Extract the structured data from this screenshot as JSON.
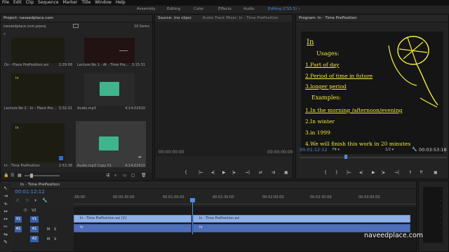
{
  "menu": [
    "File",
    "Edit",
    "Clip",
    "Sequence",
    "Marker",
    "Title",
    "Window",
    "Help"
  ],
  "workspaces": [
    {
      "label": "Assembly",
      "active": false
    },
    {
      "label": "Editing",
      "active": false
    },
    {
      "label": "Color",
      "active": false
    },
    {
      "label": "Effects",
      "active": false
    },
    {
      "label": "Audio",
      "active": false
    },
    {
      "label": "Editing (CS5.5)",
      "active": true
    }
  ],
  "project": {
    "title": "Project: naveedplace.com",
    "file": "naveedplace.com.prproj",
    "item_count": "10 Items",
    "items": [
      {
        "name": "On - Place PrePosition.avi",
        "duration": "2:29:08"
      },
      {
        "name": "Lecture No 1 - At - Time Pre...",
        "duration": "3:15:31"
      },
      {
        "name": "Lecture No 2 - In - Place Pre...",
        "duration": "3:32:31"
      },
      {
        "name": "Audio.mp3",
        "duration": "4;14;02910"
      },
      {
        "name": "In - Time PrePosition",
        "duration": "2:53:38"
      },
      {
        "name": "Audio.mp3 Copy 01",
        "duration": "4;14;02910"
      }
    ]
  },
  "source": {
    "title": "Source: (no clips)",
    "tab2": "Audio Track Mixer: In - Time PrePosition",
    "tc_left": "00:00:00:00",
    "tc_right": "00:00:00:00"
  },
  "program": {
    "title": "Program: In - Time PrePosition",
    "timecode": "00:01:12:12",
    "fit": "Fit",
    "quality": "1/2",
    "duration": "00:03:53:18"
  },
  "board": {
    "heading": "In",
    "usages": "Usages:",
    "lines": [
      "1.Part of day",
      "2.Period of time in future",
      "3.longer period"
    ],
    "examples": "Examples:",
    "ex_lines": [
      "1.In the morning /afternoon/evening",
      "2.In winter",
      "3.in 1999",
      "4.We will finish this work in 20 minutes"
    ]
  },
  "timeline": {
    "tab": "In - Time PrePosition",
    "timecode": "00:01:12:12",
    "ruler": [
      ":00:00",
      "00:00:30:00",
      "00:01:00:00",
      "00:01:30:00",
      "00:02:00:00",
      "00:02:30:00",
      "00:03:00:00"
    ],
    "tracks": {
      "v2": "V2",
      "v1": "V1",
      "a1": "A1",
      "a2": "A2",
      "src_v": "V1",
      "src_a": "A1"
    },
    "clip1": "In - Time PrePosition.avi [V]",
    "clip2": "In - Time PrePosition.avi",
    "clip_fx": "fx"
  },
  "watermark": "naveedplace.com",
  "colors": {
    "accent": "#4a8fe0",
    "board": "#f2ea3b",
    "audio_clip": "#4f6eb8",
    "video_clip": "#8fb0e6",
    "waveform": "#3fb58d"
  }
}
